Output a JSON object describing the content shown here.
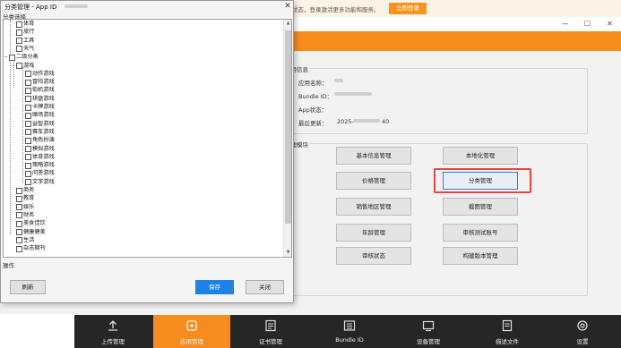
{
  "topbar": {
    "notice": "状态，登录激活更多功能和服务。",
    "login_button": "立即登录"
  },
  "app": {
    "window_controls": [
      "—",
      "☐",
      "✕"
    ],
    "info_group": {
      "title": "应用信息",
      "app_name_label": "应用名称：",
      "bundle_label": "Bundle ID：",
      "status_label": "App状态：",
      "updated_label": "最后更新：",
      "updated_prefix": "2025-",
      "updated_suffix": "40"
    },
    "manage_group": {
      "title": "管理模块",
      "buttons": [
        "基本信息管理",
        "本地化管理",
        "价格管理",
        "分类管理",
        "销售地区管理",
        "截图管理",
        "年龄管理",
        "审核测试账号",
        "审核状态",
        "构建版本管理"
      ]
    },
    "bottom_nav": [
      {
        "label": "上传管理",
        "icon": "upload-icon"
      },
      {
        "label": "应用管理",
        "icon": "app-icon",
        "active": true
      },
      {
        "label": "证书管理",
        "icon": "certificate-icon"
      },
      {
        "label": "Bundle ID",
        "icon": "bundle-icon"
      },
      {
        "label": "设备管理",
        "icon": "device-icon"
      },
      {
        "label": "描述文件",
        "icon": "profile-icon"
      },
      {
        "label": "设置",
        "icon": "gear-icon"
      }
    ]
  },
  "dialog": {
    "title": "分类管理 - App ID",
    "close": "✕",
    "section_label": "分类选择",
    "tree": [
      {
        "label": "体育",
        "level": 1
      },
      {
        "label": "旅行",
        "level": 1
      },
      {
        "label": "工具",
        "level": 1
      },
      {
        "label": "天气",
        "level": 1
      },
      {
        "label": "二级分类",
        "level": 0,
        "expand": "−"
      },
      {
        "label": "游戏",
        "level": 1,
        "expand": "−"
      },
      {
        "label": "动作游戏",
        "level": 2
      },
      {
        "label": "冒险游戏",
        "level": 2
      },
      {
        "label": "街机游戏",
        "level": 2
      },
      {
        "label": "棋盘游戏",
        "level": 2
      },
      {
        "label": "卡牌游戏",
        "level": 2
      },
      {
        "label": "赌场游戏",
        "level": 2
      },
      {
        "label": "益智游戏",
        "level": 2
      },
      {
        "label": "赛车游戏",
        "level": 2
      },
      {
        "label": "角色扮演",
        "level": 2
      },
      {
        "label": "模拟游戏",
        "level": 2
      },
      {
        "label": "体育游戏",
        "level": 2
      },
      {
        "label": "策略游戏",
        "level": 2
      },
      {
        "label": "问答游戏",
        "level": 2
      },
      {
        "label": "文字游戏",
        "level": 2
      },
      {
        "label": "商务",
        "level": 1
      },
      {
        "label": "教育",
        "level": 1
      },
      {
        "label": "娱乐",
        "level": 1
      },
      {
        "label": "财务",
        "level": 1
      },
      {
        "label": "美食佳饮",
        "level": 1
      },
      {
        "label": "健康健美",
        "level": 1
      },
      {
        "label": "生活",
        "level": 1
      },
      {
        "label": "杂志期刊",
        "level": 1
      }
    ],
    "actions_label": "操作",
    "refresh": "刷新",
    "save": "保存",
    "close_button": "关闭"
  }
}
